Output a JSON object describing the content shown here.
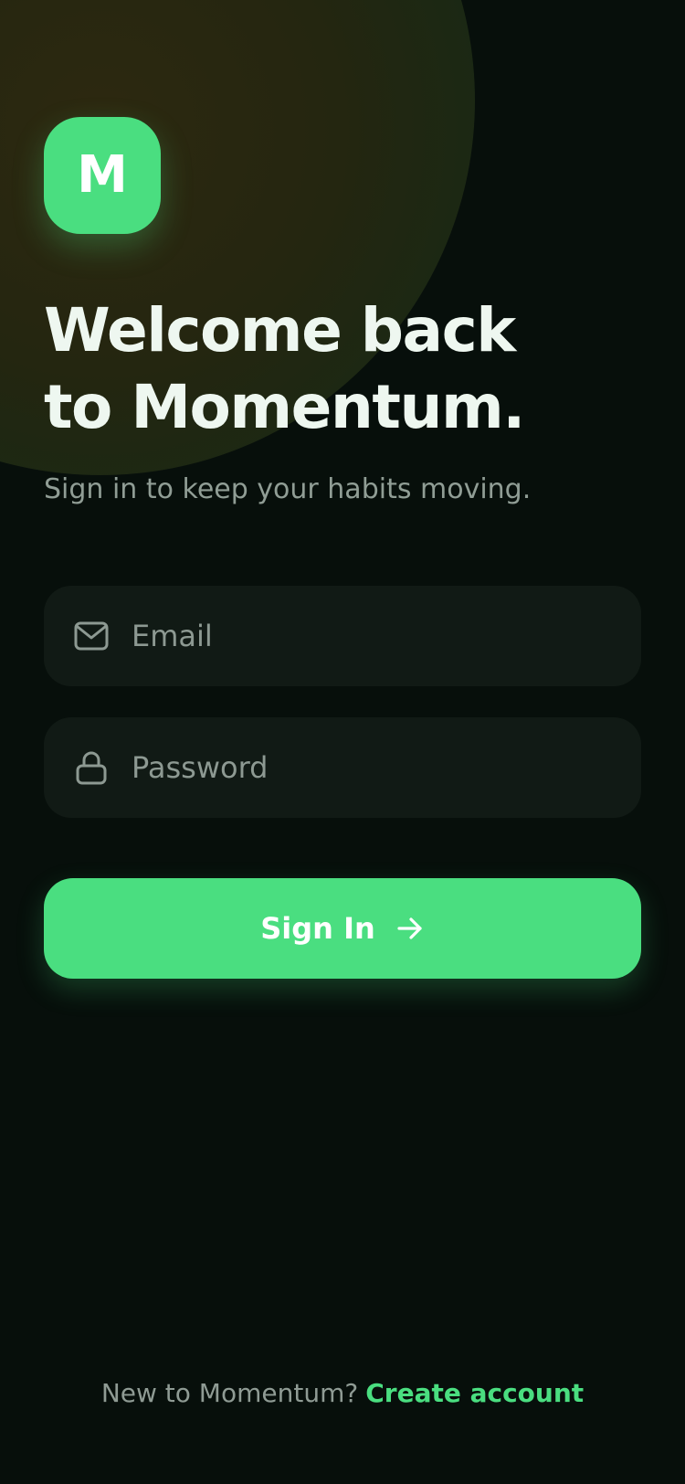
{
  "brand": {
    "logo_letter": "M",
    "accent_color": "#4ade80"
  },
  "header": {
    "title_line1": "Welcome back",
    "title_line2": "to Momentum.",
    "subtitle": "Sign in to keep your habits moving."
  },
  "form": {
    "email": {
      "placeholder": "Email",
      "value": "",
      "icon": "mail-icon"
    },
    "password": {
      "placeholder": "Password",
      "value": "",
      "icon": "lock-icon"
    },
    "submit": {
      "label": "Sign In",
      "icon": "arrow-right-icon"
    }
  },
  "footer": {
    "prompt": "New to Momentum?",
    "link_label": "Create account"
  },
  "colors": {
    "background": "#070f0b",
    "field_background": "#111a15",
    "title_text": "#eef7f0",
    "muted_text": "#909d95"
  }
}
